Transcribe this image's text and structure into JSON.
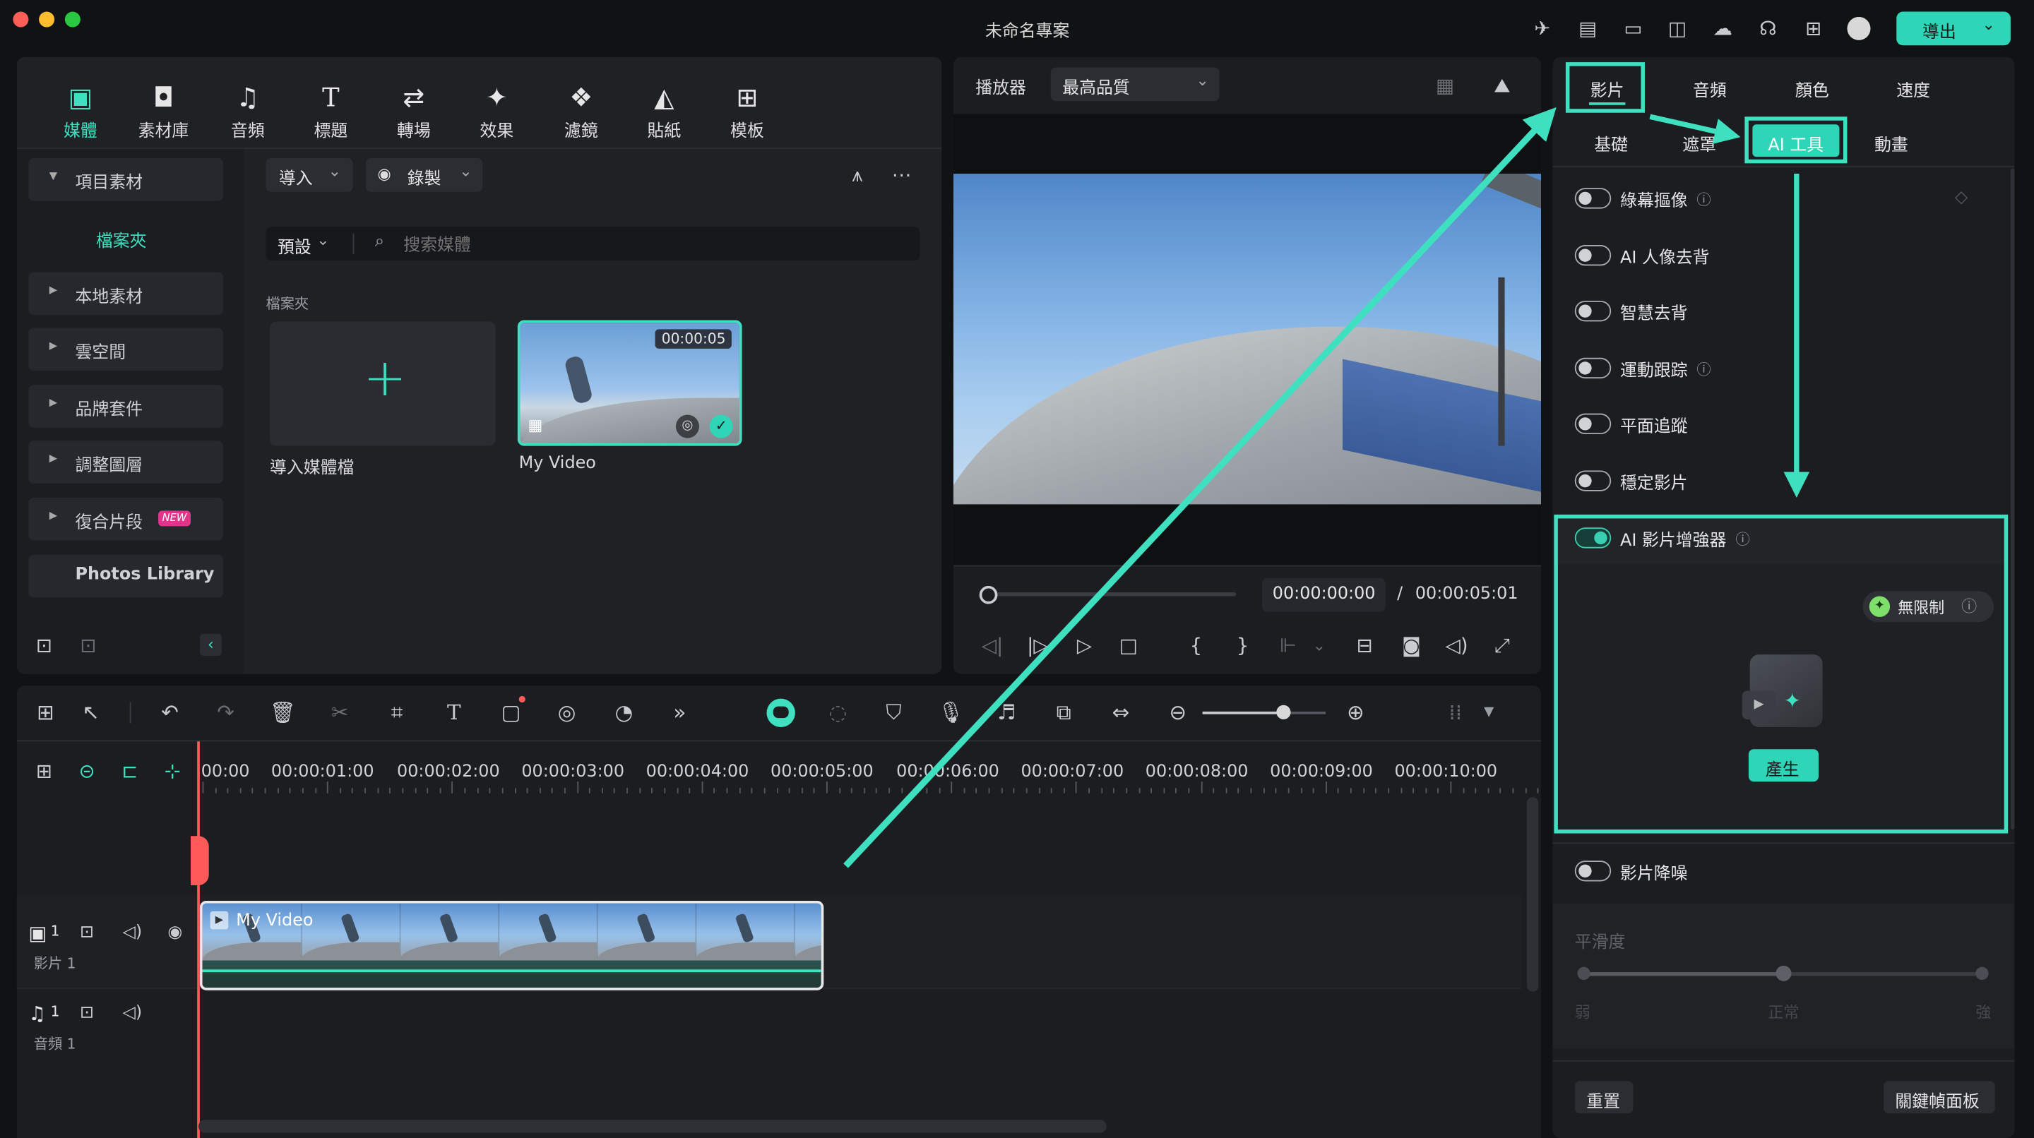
{
  "window": {
    "title": "未命名專案"
  },
  "header": {
    "export_label": "導出"
  },
  "toolbar": {
    "tools": [
      {
        "label": "媒體",
        "icon": "media-icon"
      },
      {
        "label": "素材庫",
        "icon": "stock-icon"
      },
      {
        "label": "音頻",
        "icon": "music-icon"
      },
      {
        "label": "標題",
        "icon": "title-icon"
      },
      {
        "label": "轉場",
        "icon": "transition-icon"
      },
      {
        "label": "效果",
        "icon": "effects-icon"
      },
      {
        "label": "濾鏡",
        "icon": "filters-icon"
      },
      {
        "label": "貼紙",
        "icon": "stickers-icon"
      },
      {
        "label": "模板",
        "icon": "templates-icon"
      }
    ]
  },
  "sidebar": {
    "items": [
      {
        "label": "項目素材"
      },
      {
        "label": "檔案夾"
      },
      {
        "label": "本地素材"
      },
      {
        "label": "雲空間"
      },
      {
        "label": "品牌套件"
      },
      {
        "label": "調整圖層"
      },
      {
        "label": "復合片段"
      },
      {
        "label": "Photos Library"
      }
    ],
    "new_badge": "NEW"
  },
  "media": {
    "import_label": "導入",
    "record_label": "錄製",
    "preset_label": "預設",
    "search_placeholder": "搜索媒體",
    "folder_label": "檔案夾",
    "import_tile_label": "導入媒體檔",
    "clip": {
      "name": "My Video",
      "duration": "00:00:05"
    }
  },
  "player": {
    "label": "播放器",
    "quality": "最高品質",
    "current_time": "00:00:00:00",
    "separator": "/",
    "total_time": "00:00:05:01",
    "progress": 0
  },
  "inspector": {
    "tabs": [
      "影片",
      "音頻",
      "顏色",
      "速度"
    ],
    "subtabs": [
      "基礎",
      "遮罩",
      "AI 工具",
      "動畫"
    ],
    "tools": [
      {
        "label": "綠幕摳像",
        "on": false
      },
      {
        "label": "AI 人像去背",
        "on": false
      },
      {
        "label": "智慧去背",
        "on": false
      },
      {
        "label": "運動跟踪",
        "on": false
      },
      {
        "label": "平面追蹤",
        "on": false
      },
      {
        "label": "穩定影片",
        "on": false
      }
    ],
    "enhancer": {
      "label": "AI 影片增強器",
      "on": true,
      "unlimited_label": "無限制",
      "generate_label": "產生"
    },
    "denoise": {
      "label": "影片降噪",
      "on": false
    },
    "smoothness": {
      "label": "平滑度",
      "low": "弱",
      "mid": "正常",
      "high": "強",
      "value": 0.5
    },
    "reset_label": "重置",
    "keyframe_label": "關鍵幀面板"
  },
  "timeline": {
    "ruler": [
      "00:00",
      "00:00:01:00",
      "00:00:02:00",
      "00:00:03:00",
      "00:00:04:00",
      "00:00:05:00",
      "00:00:06:00",
      "00:00:07:00",
      "00:00:08:00",
      "00:00:09:00",
      "00:00:10:00"
    ],
    "video_track": {
      "index": "1",
      "label": "影片 1",
      "clip_name": "My Video"
    },
    "audio_track": {
      "index": "1",
      "label": "音頻 1"
    },
    "zoom_value": 0.65
  },
  "colors": {
    "accent": "#3ee0c0",
    "export": "#2ed5b6",
    "playhead": "#ff5a5a",
    "bg": "#111214",
    "panel": "#1f2125"
  }
}
